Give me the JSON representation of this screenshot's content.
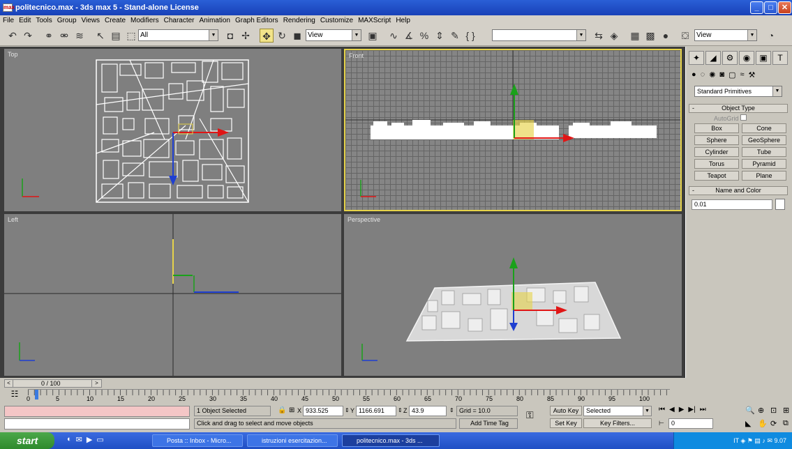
{
  "window": {
    "title": "politecnico.max - 3ds max 5 - Stand-alone License",
    "app_icon": "max",
    "minimize": "_",
    "maximize": "□",
    "close": "✕"
  },
  "menu": [
    "File",
    "Edit",
    "Tools",
    "Group",
    "Views",
    "Create",
    "Modifiers",
    "Character",
    "Animation",
    "Graph Editors",
    "Rendering",
    "Customize",
    "MAXScript",
    "Help"
  ],
  "toolbar": {
    "selection_filter": "All",
    "ref_coord": "View",
    "named_selection": "",
    "render_view": "View"
  },
  "viewports": {
    "top": "Top",
    "front": "Front",
    "left": "Left",
    "perspective": "Perspective"
  },
  "command_panel": {
    "category": "Standard Primitives",
    "object_type_header": "Object Type",
    "autogrid": "AutoGrid",
    "buttons": [
      "Box",
      "Cone",
      "Sphere",
      "GeoSphere",
      "Cylinder",
      "Tube",
      "Torus",
      "Pyramid",
      "Teapot",
      "Plane"
    ],
    "name_color_header": "Name and Color",
    "name_value": "0.01",
    "collapse": "-"
  },
  "timeline": {
    "frame_counter": "0 / 100",
    "ticks": [
      "0",
      "5",
      "10",
      "15",
      "20",
      "25",
      "30",
      "35",
      "40",
      "45",
      "50",
      "55",
      "60",
      "65",
      "70",
      "75",
      "80",
      "85",
      "90",
      "95",
      "100"
    ]
  },
  "status": {
    "selected": "1 Object Selected",
    "prompt": "Click and drag to select and move objects",
    "x_label": "X",
    "x": "933.525",
    "y_label": "Y",
    "y": "1166.691",
    "z_label": "Z",
    "z": "43.9",
    "grid": "Grid = 10.0",
    "add_time_tag": "Add Time Tag",
    "auto_key": "Auto Key",
    "key_mode": "Selected",
    "set_key": "Set Key",
    "key_filters": "Key Filters...",
    "frame": "0"
  },
  "taskbar": {
    "start": "start",
    "items": [
      "Posta :: Inbox - Micro...",
      "istruzioni esercitazion...",
      "politecnico.max - 3ds ..."
    ],
    "tray_lang": "IT",
    "clock": "9.07"
  },
  "colors": {
    "viewport_bg": "#7f7f7f",
    "active_border": "#e6d34a",
    "axis_x": "#e01515",
    "axis_y": "#1aa11a",
    "axis_z": "#1f3fd0"
  }
}
